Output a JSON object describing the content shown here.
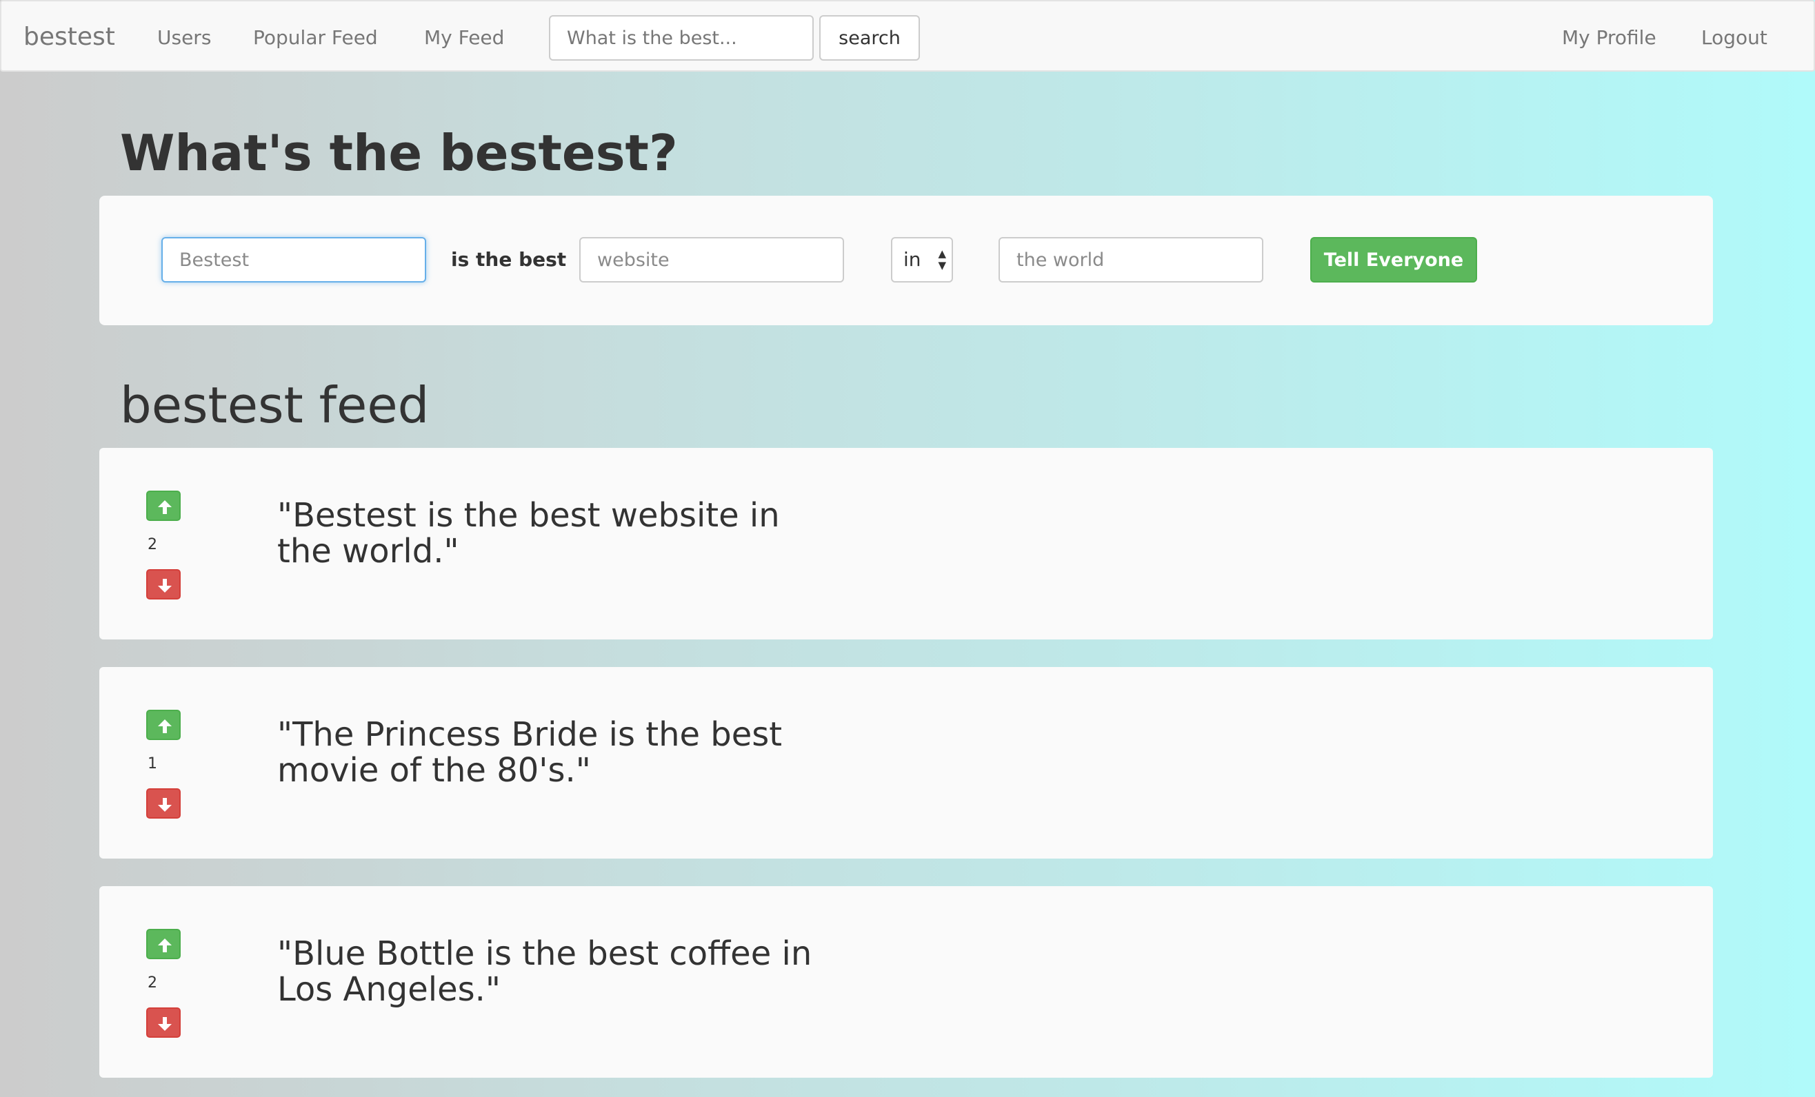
{
  "navbar": {
    "brand": "bestest",
    "links": [
      {
        "label": "Users"
      },
      {
        "label": "Popular Feed"
      },
      {
        "label": "My Feed"
      }
    ],
    "search": {
      "placeholder": "What is the best...",
      "value": "",
      "button_label": "search"
    },
    "right_links": [
      {
        "label": "My Profile"
      },
      {
        "label": "Logout"
      }
    ]
  },
  "form": {
    "heading": "What's the bestest?",
    "subject": {
      "placeholder": "Bestest",
      "value": ""
    },
    "connector": "is the best",
    "category": {
      "placeholder": "website",
      "value": ""
    },
    "preposition": {
      "selected": "in"
    },
    "location": {
      "placeholder": "the world",
      "value": ""
    },
    "submit_label": "Tell Everyone"
  },
  "feed": {
    "heading": "bestest feed",
    "items": [
      {
        "votes": "2",
        "text": "\"Bestest is the best website in the world.\""
      },
      {
        "votes": "1",
        "text": "\"The Princess Bride is the best movie of the 80's.\""
      },
      {
        "votes": "2",
        "text": "\"Blue Bottle is the best coffee in Los Angeles.\""
      }
    ]
  },
  "colors": {
    "upvote": "#5cb85c",
    "downvote": "#d9534f",
    "submit": "#5cb85c",
    "focus": "#66afe9",
    "navbar_bg": "#f8f8f8",
    "card_bg": "#fafafa"
  }
}
